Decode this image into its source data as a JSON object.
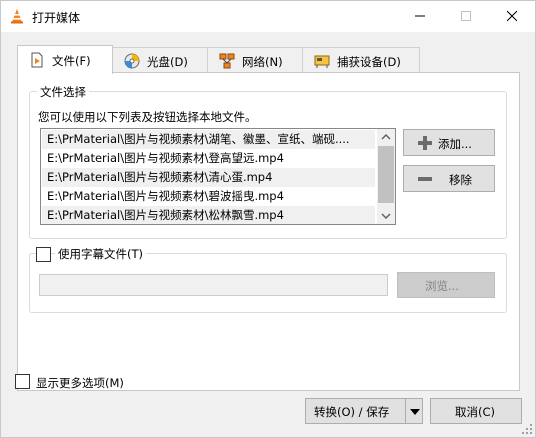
{
  "window": {
    "title": "打开媒体"
  },
  "tabs": [
    {
      "label": "文件(F)",
      "icon": "file-play-icon",
      "active": true
    },
    {
      "label": "光盘(D)",
      "icon": "disc-icon",
      "active": false
    },
    {
      "label": "网络(N)",
      "icon": "network-icon",
      "active": false
    },
    {
      "label": "捕获设备(D)",
      "icon": "capture-card-icon",
      "active": false
    }
  ],
  "file_selection": {
    "legend": "文件选择",
    "hint": "您可以使用以下列表及按钮选择本地文件。",
    "files": [
      "E:\\PrMaterial\\图片与视频素材\\湖笔、徽墨、宣纸、端砚....",
      "E:\\PrMaterial\\图片与视频素材\\登高望远.mp4",
      "E:\\PrMaterial\\图片与视频素材\\清心蛋.mp4",
      "E:\\PrMaterial\\图片与视频素材\\碧波摇曳.mp4",
      "E:\\PrMaterial\\图片与视频素材\\松林飘雪.mp4"
    ],
    "add_label": "添加...",
    "remove_label": "移除"
  },
  "subtitle": {
    "checkbox_label": "使用字幕文件(T)",
    "checked": false,
    "path_value": "",
    "browse_label": "浏览..."
  },
  "more_options": {
    "label": "显示更多选项(M)",
    "checked": false
  },
  "footer": {
    "convert_label": "转换(O) / 保存",
    "cancel_label": "取消(C)"
  },
  "colors": {
    "vlc_orange": "#f58220",
    "panel_bg": "#ffffff",
    "window_bg": "#f0f0f0"
  }
}
